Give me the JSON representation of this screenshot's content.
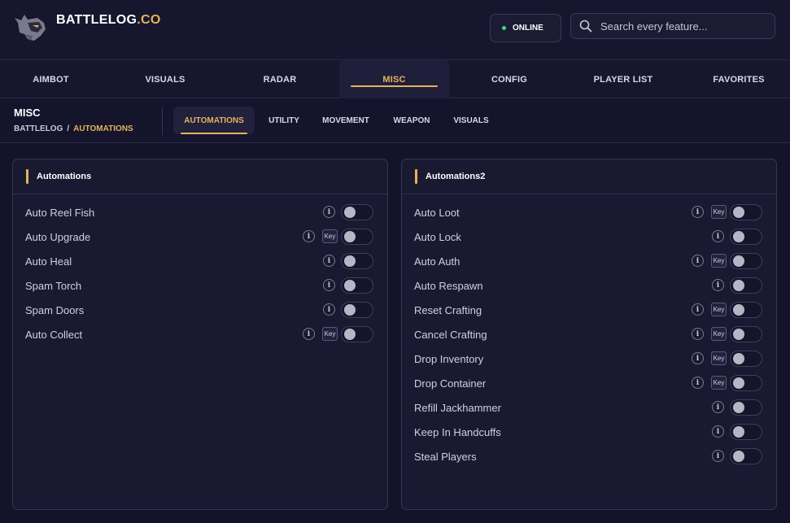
{
  "brand": {
    "name": "BATTLELOG",
    "suffix": ".CO"
  },
  "status": {
    "label": "ONLINE",
    "color": "#3ddc84"
  },
  "search": {
    "placeholder": "Search every feature..."
  },
  "colors": {
    "accent": "#e6b25a",
    "background": "#13132a"
  },
  "nav": {
    "tabs": [
      {
        "label": "AIMBOT"
      },
      {
        "label": "VISUALS"
      },
      {
        "label": "RADAR"
      },
      {
        "label": "MISC",
        "active": true
      },
      {
        "label": "CONFIG"
      },
      {
        "label": "PLAYER LIST"
      },
      {
        "label": "FAVORITES"
      }
    ]
  },
  "section": {
    "title": "MISC",
    "breadcrumb": {
      "root": "BATTLELOG",
      "separator": "/",
      "current": "AUTOMATIONS"
    },
    "subtabs": [
      {
        "label": "AUTOMATIONS",
        "active": true
      },
      {
        "label": "UTILITY"
      },
      {
        "label": "MOVEMENT"
      },
      {
        "label": "WEAPON"
      },
      {
        "label": "VISUALS"
      }
    ]
  },
  "panels": [
    {
      "title": "Automations",
      "rows": [
        {
          "label": "Auto Reel Fish",
          "info": "i",
          "key": null,
          "enabled": false
        },
        {
          "label": "Auto Upgrade",
          "info": "i",
          "key": "Key",
          "enabled": false
        },
        {
          "label": "Auto Heal",
          "info": "i",
          "key": null,
          "enabled": false
        },
        {
          "label": "Spam Torch",
          "info": "i",
          "key": null,
          "enabled": false
        },
        {
          "label": "Spam Doors",
          "info": "i",
          "key": null,
          "enabled": false
        },
        {
          "label": "Auto Collect",
          "info": "i",
          "key": "Key",
          "enabled": false
        }
      ]
    },
    {
      "title": "Automations2",
      "rows": [
        {
          "label": "Auto Loot",
          "info": "i",
          "key": "Key",
          "enabled": false
        },
        {
          "label": "Auto Lock",
          "info": "i",
          "key": null,
          "enabled": false
        },
        {
          "label": "Auto Auth",
          "info": "i",
          "key": "Key",
          "enabled": false
        },
        {
          "label": "Auto Respawn",
          "info": "i",
          "key": null,
          "enabled": false
        },
        {
          "label": "Reset Crafting",
          "info": "i",
          "key": "Key",
          "enabled": false
        },
        {
          "label": "Cancel Crafting",
          "info": "i",
          "key": "Key",
          "enabled": false
        },
        {
          "label": "Drop Inventory",
          "info": "i",
          "key": "Key",
          "enabled": false
        },
        {
          "label": "Drop Container",
          "info": "i",
          "key": "Key",
          "enabled": false
        },
        {
          "label": "Refill Jackhammer",
          "info": "i",
          "key": null,
          "enabled": false
        },
        {
          "label": "Keep In Handcuffs",
          "info": "i",
          "key": null,
          "enabled": false
        },
        {
          "label": "Steal Players",
          "info": "i",
          "key": null,
          "enabled": false
        }
      ]
    }
  ]
}
